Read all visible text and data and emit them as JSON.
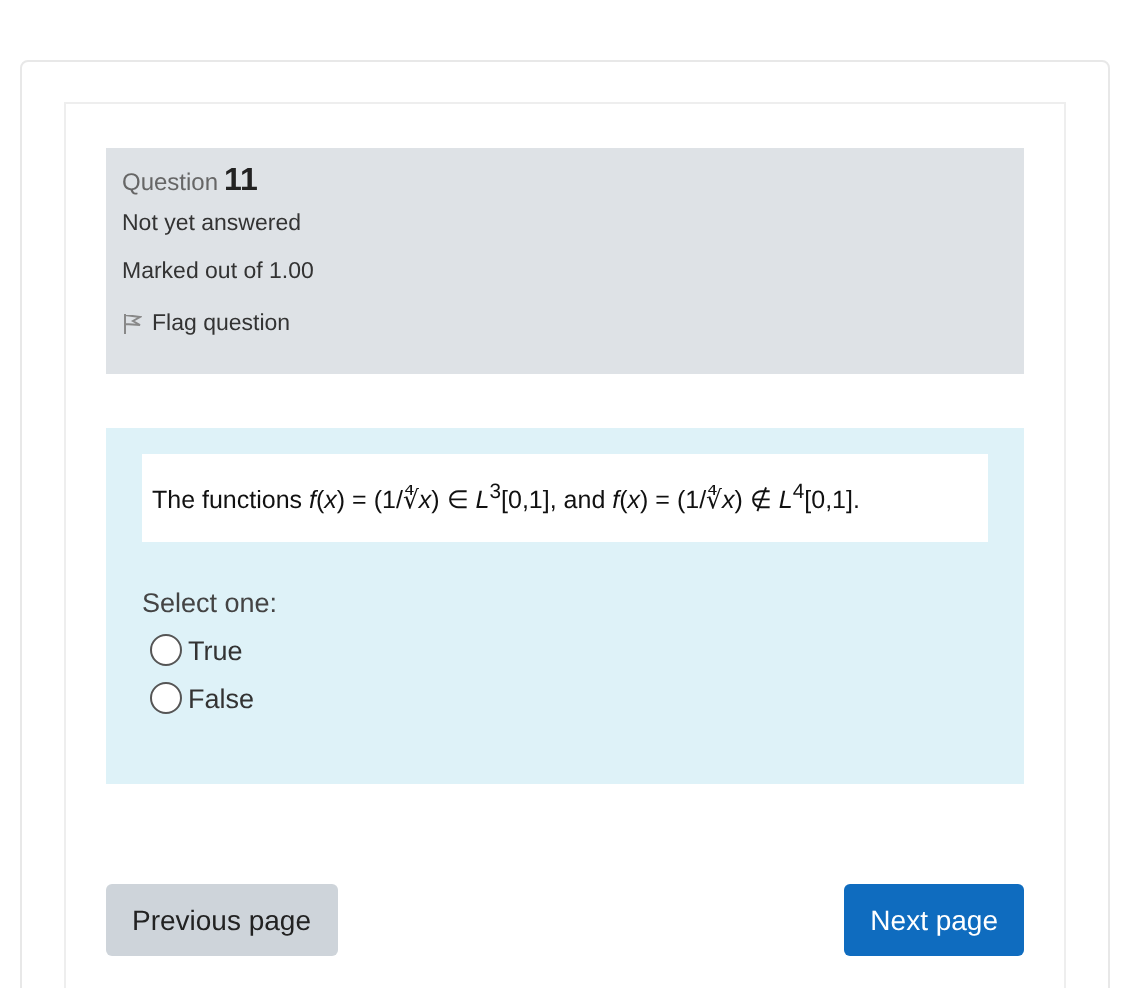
{
  "question": {
    "label": "Question",
    "number": "11",
    "status": "Not yet answered",
    "marks": "Marked out of 1.00",
    "flag": {
      "label": "Flag question",
      "flagged": false
    }
  },
  "content": {
    "text": "The functions *f*(*x*) = (1/∜*x*) ∈ *L*$^{3}$[0,1], and *f*(*x*) = (1/∜*x*) ∉ *L*$^{4}$[0,1].",
    "prompt": "Select one:",
    "options": [
      {
        "label": "True",
        "selected": false
      },
      {
        "label": "False",
        "selected": false
      }
    ]
  },
  "buttons": [
    {
      "label": "Previous page",
      "kind": "secondary"
    },
    {
      "label": "Next page",
      "kind": "primary"
    }
  ]
}
